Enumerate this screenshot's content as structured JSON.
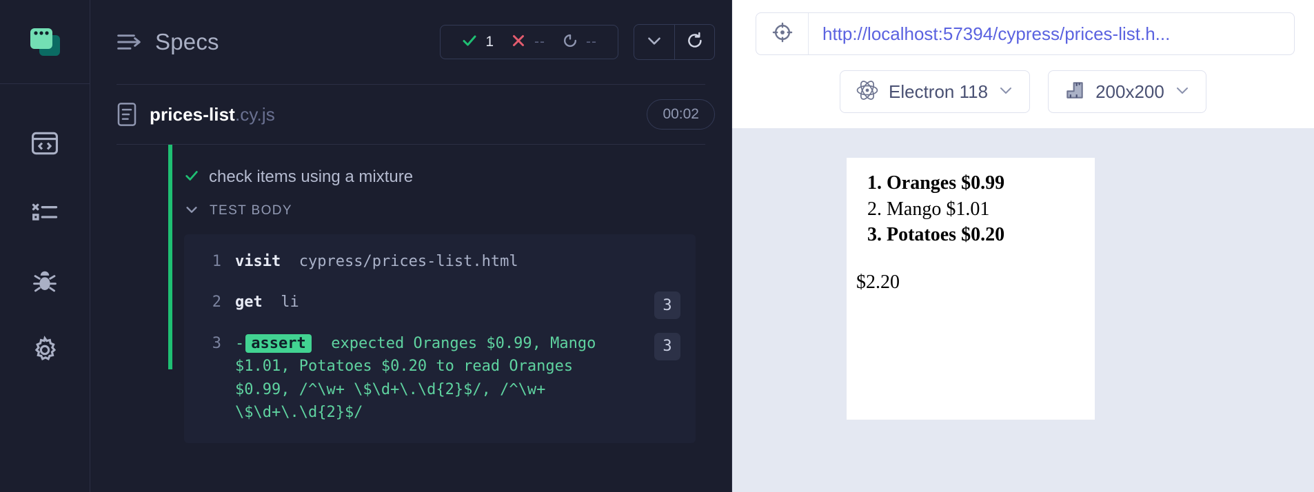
{
  "sidebar": {
    "logo_name": "cypress-logo",
    "items": [
      {
        "name": "specs",
        "icon": "code-window-icon"
      },
      {
        "name": "runs",
        "icon": "test-list-icon"
      },
      {
        "name": "debug",
        "icon": "bug-icon"
      },
      {
        "name": "settings",
        "icon": "gear-icon"
      }
    ]
  },
  "reporter": {
    "title": "Specs",
    "stats": {
      "passed": "1",
      "failed": "--",
      "pending": "--"
    },
    "controls": {
      "chevron_label": "chevron-down",
      "reload_label": "reload"
    },
    "spec": {
      "name": "prices-list",
      "ext": ".cy.js",
      "duration": "00:02"
    },
    "test": {
      "title": "check items using a mixture",
      "body_label": "TEST BODY",
      "status": "passed"
    },
    "commands": [
      {
        "num": "1",
        "method": "visit",
        "arg": "cypress/prices-list.html",
        "badge": ""
      },
      {
        "num": "2",
        "method": "get",
        "arg": "li",
        "badge": "3"
      },
      {
        "num": "3",
        "prefix": "-",
        "chip": "assert",
        "arg": "expected Oranges $0.99, Mango $1.01, Potatoes $0.20 to read Oranges $0.99, /^\\w+ \\$\\d+\\.\\d{2}$/, /^\\w+ \\$\\d+\\.\\d{2}$/",
        "badge": "3"
      }
    ]
  },
  "aut": {
    "url": "http://localhost:57394/cypress/prices-list.h...",
    "browser": "Electron 118",
    "viewport": "200x200",
    "page": {
      "items": [
        {
          "text": "Oranges $0.99",
          "bold": true
        },
        {
          "text": "Mango $1.01",
          "bold": false
        },
        {
          "text": "Potatoes $0.20",
          "bold": true
        }
      ],
      "total": "$2.20"
    }
  },
  "colors": {
    "pass_green": "#1fbf73",
    "fail_red": "#e45c6e",
    "assert_green": "#42d392",
    "url_indigo": "#5b63e0",
    "panel_dark": "#1b1e2e"
  }
}
